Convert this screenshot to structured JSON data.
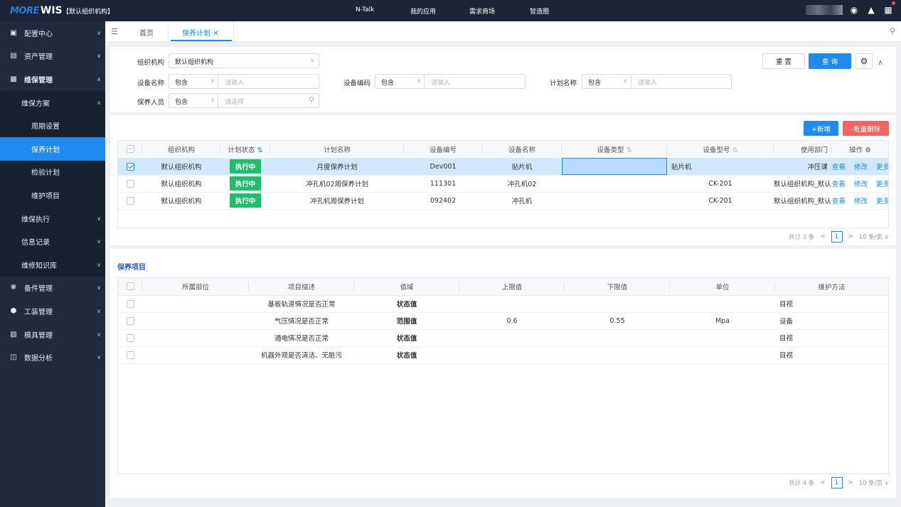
{
  "topbar": {
    "logo_part1": "MORE",
    "logo_part2": "WIS",
    "org": "【默认组织机构】",
    "nav": [
      "N-Talk",
      "我的应用",
      "需求商场",
      "智造圈"
    ]
  },
  "sidebar": {
    "items": [
      {
        "label": "配置中心",
        "icon": "id-card-icon"
      },
      {
        "label": "资产管理",
        "icon": "list-icon"
      },
      {
        "label": "维保管理",
        "icon": "calendar-icon"
      },
      {
        "label": "维保方案"
      },
      {
        "label": "周期设置"
      },
      {
        "label": "保养计划"
      },
      {
        "label": "检验计划"
      },
      {
        "label": "维护项目"
      },
      {
        "label": "维保执行"
      },
      {
        "label": "信息记录"
      },
      {
        "label": "维修知识库"
      },
      {
        "label": "备件管理",
        "icon": "gear-icon"
      },
      {
        "label": "工装管理",
        "icon": "box-icon"
      },
      {
        "label": "模具管理",
        "icon": "mold-icon"
      },
      {
        "label": "数据分析",
        "icon": "chart-icon"
      }
    ]
  },
  "tabs": {
    "home": "首页",
    "active": "保养计划"
  },
  "filter": {
    "org_label": "组织机构",
    "org_value": "默认组织机构",
    "equip_name_label": "设备名称",
    "equip_code_label": "设备编码",
    "plan_name_label": "计划名称",
    "person_label": "保养人员",
    "op_contains": "包含",
    "input_placeholder": "请输入",
    "select_placeholder": "请选择",
    "reset": "重 置",
    "query": "查 询"
  },
  "plan_table": {
    "add_label": "+新增",
    "delete_label": "-批量删除",
    "headers": [
      "组织机构",
      "计划状态",
      "计划名称",
      "设备编号",
      "设备名称",
      "设备类型",
      "设备型号",
      "使用部门",
      "操作"
    ],
    "actions": [
      "查看",
      "修改",
      "更多"
    ],
    "rows": [
      {
        "org": "默认组织机构",
        "status": "执行中",
        "name": "月度保养计划",
        "code": "Dev001",
        "equip": "贴片机",
        "type": "",
        "model": "贴片机",
        "dept": "冲压课",
        "selected": true
      },
      {
        "org": "默认组织机构",
        "status": "执行中",
        "name": "冲孔机02周保养计划",
        "code": "111301",
        "equip": "冲孔机02",
        "type": "",
        "model": "CK-201",
        "dept": "默认组织机构_默认",
        "selected": false
      },
      {
        "org": "默认组织机构",
        "status": "执行中",
        "name": "冲孔机周保养计划",
        "code": "092402",
        "equip": "冲孔机",
        "type": "",
        "model": "CK-201",
        "dept": "默认组织机构_默认",
        "selected": false
      }
    ],
    "pager": {
      "total": "共计 3 条",
      "page": "1",
      "size": "10 条/页"
    }
  },
  "items_section": {
    "title": "保养项目",
    "headers": [
      "所属部位",
      "项目描述",
      "值域",
      "上限值",
      "下限值",
      "单位",
      "维护方法"
    ],
    "rows": [
      {
        "part": "",
        "desc": "基板轨道情况是否正常",
        "domain": "状态值",
        "upper": "",
        "lower": "",
        "unit": "",
        "method": "目视"
      },
      {
        "part": "",
        "desc": "气压情况是否正常",
        "domain": "范围值",
        "upper": "0.6",
        "lower": "0.55",
        "unit": "Mpa",
        "method": "设备"
      },
      {
        "part": "",
        "desc": "通电情况是否正常",
        "domain": "状态值",
        "upper": "",
        "lower": "",
        "unit": "",
        "method": "目视"
      },
      {
        "part": "",
        "desc": "机器外观是否清洁、无脏污",
        "domain": "状态值",
        "upper": "",
        "lower": "",
        "unit": "",
        "method": "目视"
      }
    ],
    "pager": {
      "total": "共计 4 条",
      "page": "1",
      "size": "10 条/页"
    }
  },
  "colors": {
    "accent": "#1f8bf0",
    "status_green": "#1ebf6a",
    "danger": "#f06464",
    "sidebar_bg": "#1f2a3b"
  }
}
